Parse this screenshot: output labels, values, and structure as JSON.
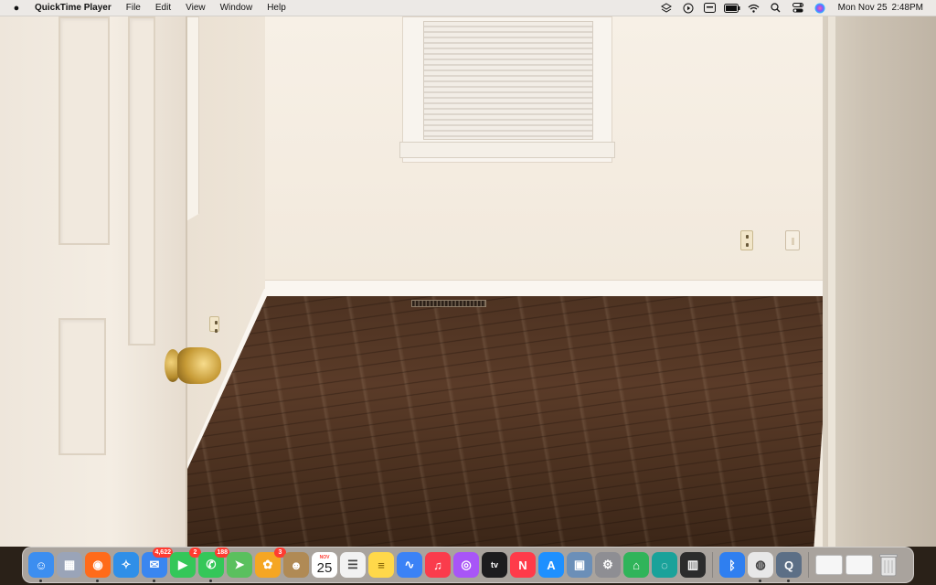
{
  "menubar": {
    "app_name": "QuickTime Player",
    "menus": [
      "File",
      "Edit",
      "View",
      "Window",
      "Help"
    ],
    "date": "Mon Nov 25",
    "time": "2:48PM"
  },
  "dock": {
    "items": [
      {
        "name": "finder",
        "icon": "finder-icon",
        "color": "#3c8ef0",
        "glyph": "☺",
        "running": true
      },
      {
        "name": "launchpad",
        "icon": "launchpad-icon",
        "color": "#9aa4b8",
        "glyph": "▦",
        "running": false
      },
      {
        "name": "firefox",
        "icon": "firefox-icon",
        "color": "#ff6b1a",
        "glyph": "◉",
        "running": true
      },
      {
        "name": "safari",
        "icon": "safari-icon",
        "color": "#2f8fe8",
        "glyph": "✧",
        "running": false
      },
      {
        "name": "mail",
        "icon": "mail-icon",
        "color": "#3a86f0",
        "glyph": "✉",
        "badge": "4,622",
        "running": true
      },
      {
        "name": "facetime",
        "icon": "facetime-icon",
        "color": "#34c759",
        "glyph": "▶",
        "badge": "2",
        "running": false
      },
      {
        "name": "messages",
        "icon": "messages-icon",
        "color": "#34c759",
        "glyph": "✆",
        "badge": "188",
        "running": true
      },
      {
        "name": "maps",
        "icon": "maps-icon",
        "color": "#5ac05e",
        "glyph": "➤",
        "running": false
      },
      {
        "name": "photos",
        "icon": "photos-icon",
        "color": "#f5a623",
        "glyph": "✿",
        "badge": "3",
        "running": false
      },
      {
        "name": "contacts",
        "icon": "contacts-icon",
        "color": "#b08a55",
        "glyph": "☻",
        "running": false
      },
      {
        "name": "calendar",
        "icon": "calendar-icon",
        "month": "NOV",
        "day": "25",
        "running": false
      },
      {
        "name": "reminders",
        "icon": "reminders-icon",
        "color": "#f2f2f2",
        "glyph": "☰",
        "running": false
      },
      {
        "name": "notes",
        "icon": "notes-icon",
        "color": "#ffd84a",
        "glyph": "≡",
        "running": false
      },
      {
        "name": "freeform",
        "icon": "freeform-icon",
        "color": "#3b82f6",
        "glyph": "∿",
        "running": false
      },
      {
        "name": "music",
        "icon": "music-icon",
        "color": "#fa3c4c",
        "glyph": "♫",
        "running": false
      },
      {
        "name": "podcasts",
        "icon": "podcasts-icon",
        "color": "#a855f7",
        "glyph": "◎",
        "running": false
      },
      {
        "name": "apple-tv",
        "icon": "apple-tv-icon",
        "color": "#1c1c1e",
        "glyph": "tv",
        "running": false
      },
      {
        "name": "news",
        "icon": "news-icon",
        "color": "#ff3b4a",
        "glyph": "N",
        "running": false
      },
      {
        "name": "app-store",
        "icon": "app-store-icon",
        "color": "#1e90ff",
        "glyph": "A",
        "running": false
      },
      {
        "name": "preview",
        "icon": "preview-icon",
        "color": "#6b8fb8",
        "glyph": "▣",
        "running": false
      },
      {
        "name": "system-settings",
        "icon": "system-settings-icon",
        "color": "#8e8e93",
        "glyph": "⚙",
        "running": false
      },
      {
        "name": "home",
        "icon": "home-icon",
        "color": "#30b45a",
        "glyph": "⌂",
        "running": false
      },
      {
        "name": "spiral-app",
        "icon": "spiral-app-icon",
        "color": "#1aa29a",
        "glyph": "◌",
        "running": false
      },
      {
        "name": "piano",
        "icon": "piano-icon",
        "color": "#2c2c2c",
        "glyph": "▥",
        "running": false
      },
      {
        "name": "bluetooth",
        "icon": "bluetooth-icon",
        "color": "#2f7ff0",
        "glyph": "ᛒ",
        "running": false
      },
      {
        "name": "chrome",
        "icon": "chrome-icon",
        "color": "#e8e8e8",
        "glyph": "◍",
        "running": true
      },
      {
        "name": "quicktime",
        "icon": "quicktime-icon",
        "color": "#5c6f86",
        "glyph": "Q",
        "running": true
      }
    ],
    "stack_items": [
      {
        "name": "document-stack-1",
        "icon": "document-thumbnail-icon"
      },
      {
        "name": "document-stack-2",
        "icon": "document-thumbnail-icon"
      }
    ],
    "trash": {
      "name": "trash",
      "icon": "trash-icon"
    }
  }
}
